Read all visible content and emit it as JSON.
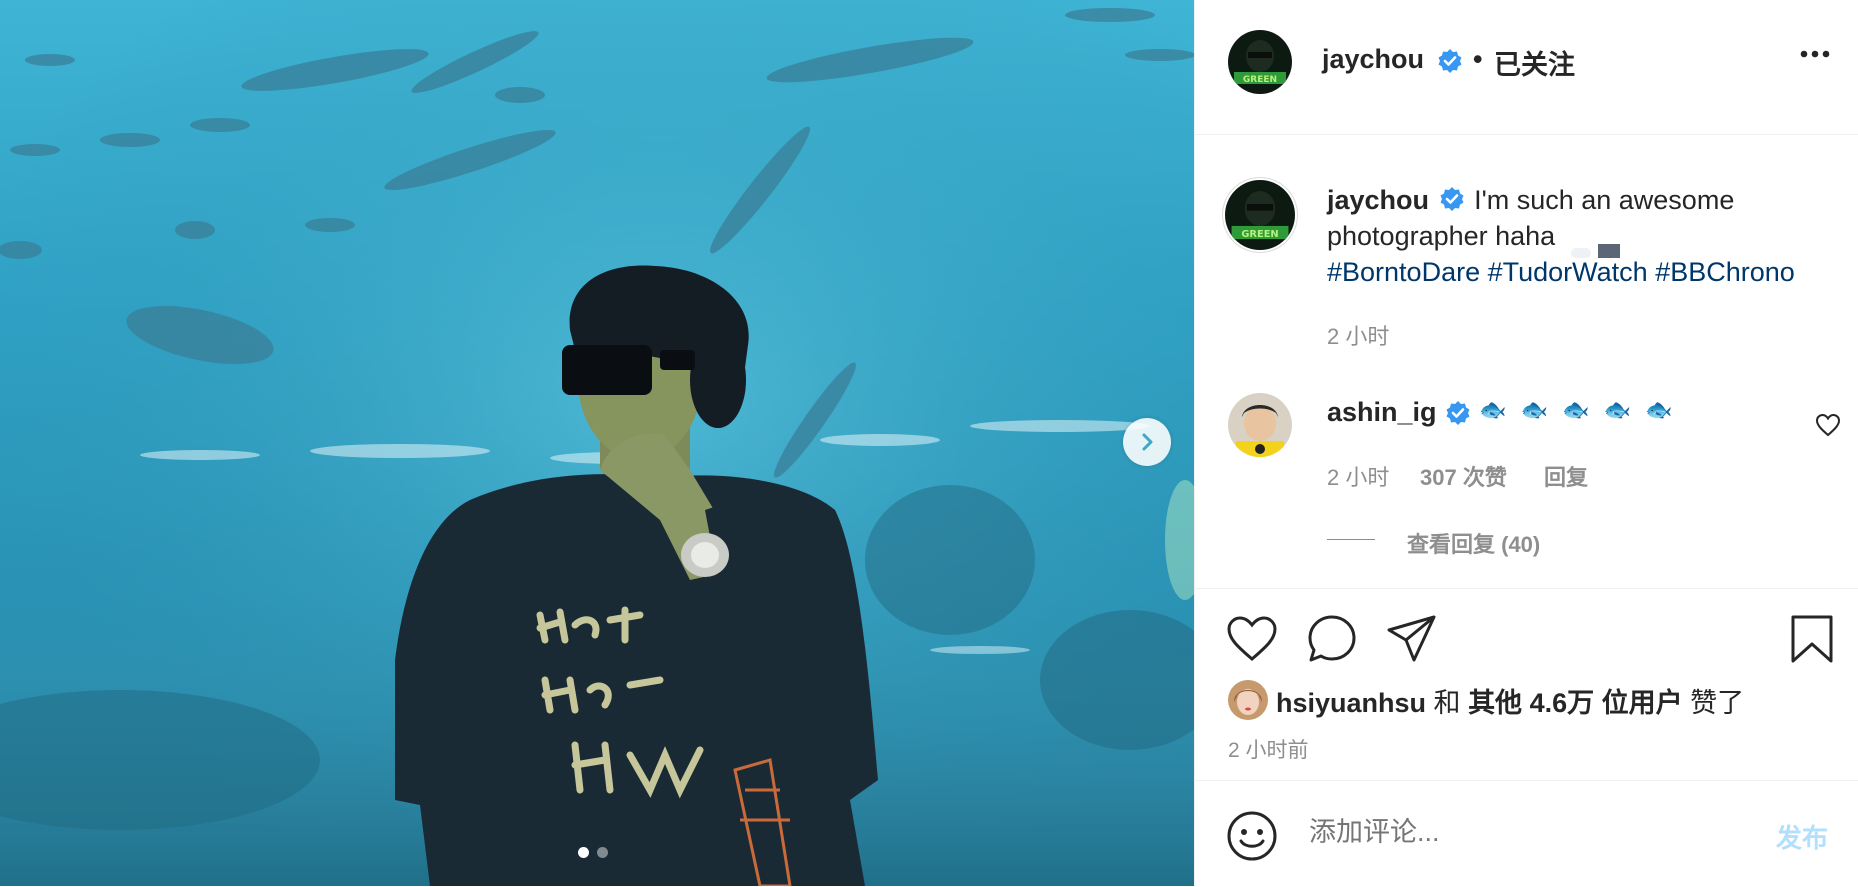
{
  "author": {
    "username": "jaychou",
    "follow_status": "已关注",
    "separator": "•",
    "verified": true
  },
  "caption": {
    "username": "jaychou",
    "text": "I'm such an awesome photographer haha",
    "hashtags": [
      "#BorntoDare",
      "#TudorWatch",
      "#BBChrono"
    ],
    "time": "2 小时"
  },
  "comment": {
    "username": "ashin_ig",
    "text": "🐟 🐟 🐟 🐟 🐟",
    "time": "2 小时",
    "likes": "307 次赞",
    "reply": "回复",
    "view_replies": "查看回复 (40)"
  },
  "likes_line": {
    "user": "hsiyuanhsu",
    "and": "和",
    "others": "其他 4.6万 位用户",
    "suffix": "赞了"
  },
  "post_time": "2 小时前",
  "comment_input": {
    "placeholder": "添加评论..."
  },
  "post_button": "发布",
  "carousel": {
    "current": 1,
    "total": 2
  },
  "colors": {
    "verified": "#3897f0",
    "hashtag": "#00376b",
    "muted": "#8e8e8e",
    "post_button": "#b2dffc",
    "water": "#2fa1c4"
  },
  "icons": [
    "more-icon",
    "heart-icon",
    "comment-icon",
    "share-icon",
    "save-icon",
    "emoji-icon",
    "chevron-right-icon",
    "verified-icon"
  ]
}
